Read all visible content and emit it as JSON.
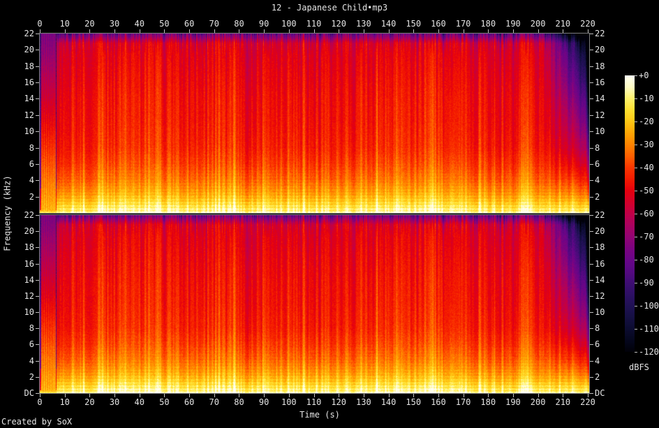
{
  "title": "12 - Japanese Child•mp3",
  "footer": "Created by SoX",
  "axes": {
    "time": {
      "label": "Time (s)",
      "ticks": [
        "0",
        "10",
        "20",
        "30",
        "40",
        "50",
        "60",
        "70",
        "80",
        "90",
        "100",
        "110",
        "120",
        "130",
        "140",
        "150",
        "160",
        "170",
        "180",
        "190",
        "200",
        "210",
        "220"
      ]
    },
    "frequency": {
      "label": "Frequency (kHz)",
      "panel_ticks": [
        "22",
        "20",
        "18",
        "16",
        "14",
        "12",
        "10",
        "8",
        "6",
        "4",
        "2"
      ],
      "dc_label": "DC"
    }
  },
  "colorbar": {
    "unit": "dBFS",
    "ticks": [
      "+0",
      "-10",
      "-20",
      "-30",
      "-40",
      "-50",
      "-60",
      "-70",
      "-80",
      "-90",
      "-100",
      "-110",
      "-120"
    ]
  },
  "colors": {
    "background": "#000000",
    "frame": "#7c7c7c",
    "tick": "#bfbfbf",
    "text": "#e4e4e4"
  },
  "chart_data": {
    "type": "heatmap",
    "subtype": "stereo-audio-spectrogram",
    "title": "12 - Japanese Child•mp3",
    "xlabel": "Time (s)",
    "ylabel": "Frequency (kHz)",
    "x_range_s": [
      0,
      220.6
    ],
    "x_tick_step_s": 10,
    "y_range_khz": [
      0,
      22
    ],
    "y_tick_step_khz": 2,
    "dbfs_range": [
      -120,
      0
    ],
    "channels": [
      "left",
      "right"
    ],
    "legend": "dBFS",
    "palette_dbfs_hex": [
      [
        0,
        "#fffff4"
      ],
      [
        -5,
        "#fffcc4"
      ],
      [
        -10,
        "#fff26a"
      ],
      [
        -15,
        "#ffe030"
      ],
      [
        -20,
        "#ffc714"
      ],
      [
        -25,
        "#ffa504"
      ],
      [
        -30,
        "#ff8400"
      ],
      [
        -35,
        "#ff6000"
      ],
      [
        -40,
        "#fb3600"
      ],
      [
        -45,
        "#f41a00"
      ],
      [
        -50,
        "#e6000e"
      ],
      [
        -55,
        "#d4002a"
      ],
      [
        -60,
        "#c10048"
      ],
      [
        -65,
        "#ab0260"
      ],
      [
        -70,
        "#930473"
      ],
      [
        -75,
        "#7c0380"
      ],
      [
        -81,
        "#660689"
      ],
      [
        -86,
        "#520a80"
      ],
      [
        -90,
        "#3f0d74"
      ],
      [
        -95,
        "#2e1065"
      ],
      [
        -100,
        "#201155"
      ],
      [
        -105,
        "#151043"
      ],
      [
        -110,
        "#0c0c31"
      ],
      [
        -115,
        "#05071e"
      ],
      [
        -120,
        "#010109"
      ]
    ],
    "freq_profile_db": [
      [
        0,
        -7
      ],
      [
        0.4,
        -11
      ],
      [
        1,
        -16
      ],
      [
        1.6,
        -21
      ],
      [
        2.5,
        -27
      ],
      [
        4,
        -34
      ],
      [
        6,
        -40
      ],
      [
        8,
        -44
      ],
      [
        11,
        -46
      ],
      [
        14,
        -47
      ],
      [
        17,
        -49
      ],
      [
        19.5,
        -51
      ],
      [
        20.8,
        -54
      ],
      [
        21.5,
        -63
      ],
      [
        22,
        -70
      ]
    ],
    "events": {
      "duration_s": 220.6,
      "intro_end_s": 6.6,
      "intro_noise_floor_db": -74,
      "intro_hits_s": [
        0.9,
        1.8,
        2.7,
        3.6,
        4.5,
        5.4,
        6.1
      ],
      "fade_out_start_s": 202,
      "fade_out_full_s": 219.5
    },
    "texture": {
      "seed": 20127,
      "beat_bright_boost_db": 8,
      "beat_dark_dip_db": 10,
      "pixel_noise_db": 3.2,
      "hf_streak_db": 5,
      "harmonic_ripple_db": 3.4,
      "dc_line_db": -13
    }
  }
}
